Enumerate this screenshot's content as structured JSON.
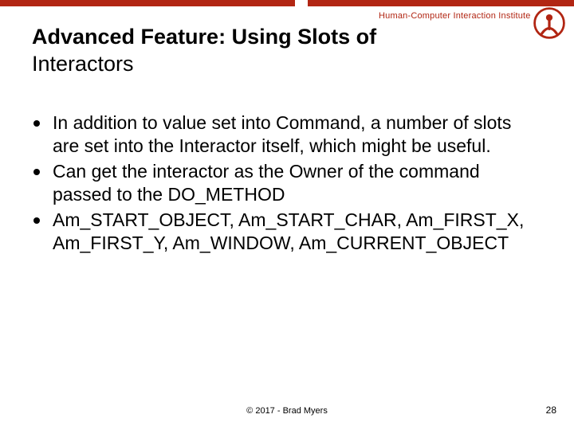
{
  "header": {
    "org_label": "Human-Computer Interaction Institute",
    "accent_color": "#b22613"
  },
  "title": {
    "line1": "Advanced Feature: Using Slots of",
    "line2": "Interactors"
  },
  "bullets": [
    "In addition to value set into Command, a number of slots are set into the Interactor itself, which might be useful.",
    "Can get the interactor as the Owner of the command passed to the DO_METHOD",
    "Am_START_OBJECT, Am_START_CHAR, Am_FIRST_X, Am_FIRST_Y, Am_WINDOW, Am_CURRENT_OBJECT"
  ],
  "footer": {
    "copyright": "© 2017 - Brad Myers",
    "page_number": "28"
  }
}
